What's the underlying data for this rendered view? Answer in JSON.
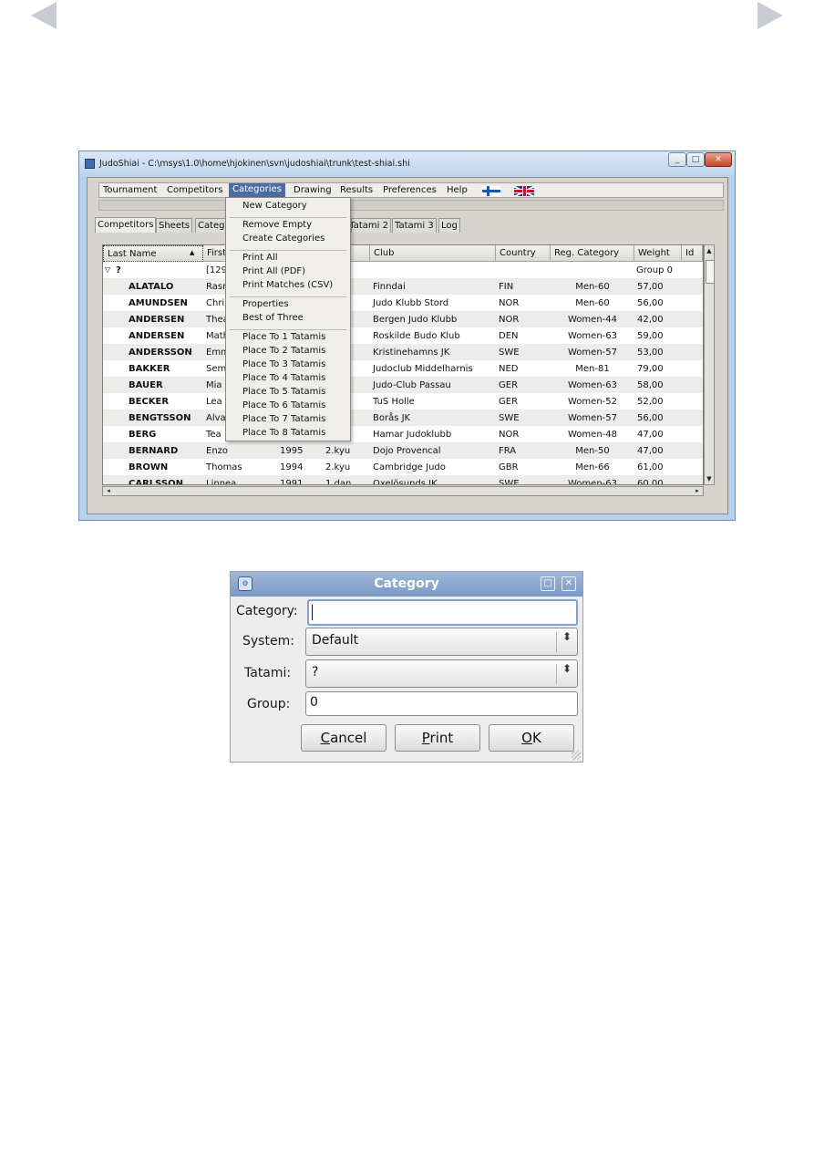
{
  "page": {
    "prev_icon": "triangle-left-icon",
    "next_icon": "triangle-right-icon"
  },
  "main_window": {
    "title": "JudoShiai - C:\\msys\\1.0\\home\\hjokinen\\svn\\judoshiai\\trunk\\test-shiai.shi",
    "window_buttons": {
      "minimize": "_",
      "maximize": "□",
      "close": "✕"
    },
    "menu": [
      "Tournament",
      "Competitors",
      "Categories",
      "Drawing",
      "Results",
      "Preferences",
      "Help"
    ],
    "active_menu": "Categories",
    "flags": [
      "finnish-flag-icon",
      "uk-flag-icon"
    ],
    "tabs": [
      "Competitors",
      "Sheets",
      "Catego",
      "Tatami 2",
      "Tatami 3",
      "Log"
    ],
    "active_tab": "Competitors",
    "columns": [
      "Last Name",
      "First",
      "Club",
      "Country",
      "Reg. Category",
      "Weight",
      "Id"
    ],
    "sort_indicator": "▲",
    "group_row": {
      "expander": "▽",
      "label": "?",
      "first": "[129",
      "weight": "Group 0"
    },
    "rows": [
      {
        "last": "ALATALO",
        "first": "Rasm",
        "birth": "",
        "grade": "",
        "club": "Finndai",
        "country": "FIN",
        "category": "Men-60",
        "weight": "57,00"
      },
      {
        "last": "AMUNDSEN",
        "first": "Chris",
        "birth": "",
        "grade": "",
        "club": "Judo Klubb Stord",
        "country": "NOR",
        "category": "Men-60",
        "weight": "56,00"
      },
      {
        "last": "ANDERSEN",
        "first": "Thea",
        "birth": "",
        "grade": "",
        "club": "Bergen Judo Klubb",
        "country": "NOR",
        "category": "Women-44",
        "weight": "42,00"
      },
      {
        "last": "ANDERSEN",
        "first": "Math",
        "birth": "",
        "grade": "",
        "club": "Roskilde Budo Klub",
        "country": "DEN",
        "category": "Women-63",
        "weight": "59,00"
      },
      {
        "last": "ANDERSSON",
        "first": "Emm",
        "birth": "",
        "grade": "",
        "club": "Kristinehamns JK",
        "country": "SWE",
        "category": "Women-57",
        "weight": "53,00"
      },
      {
        "last": "BAKKER",
        "first": "Sem",
        "birth": "",
        "grade": "",
        "club": "Judoclub Middelharnis",
        "country": "NED",
        "category": "Men-81",
        "weight": "79,00"
      },
      {
        "last": "BAUER",
        "first": "Mia",
        "birth": "",
        "grade": "",
        "club": "Judo-Club Passau",
        "country": "GER",
        "category": "Women-63",
        "weight": "58,00"
      },
      {
        "last": "BECKER",
        "first": "Lea",
        "birth": "",
        "grade": "",
        "club": "TuS Holle",
        "country": "GER",
        "category": "Women-52",
        "weight": "52,00"
      },
      {
        "last": "BENGTSSON",
        "first": "Alva",
        "birth": "",
        "grade": "",
        "club": "Borås JK",
        "country": "SWE",
        "category": "Women-57",
        "weight": "56,00"
      },
      {
        "last": "BERG",
        "first": "Tea",
        "birth": "",
        "grade": "",
        "club": "Hamar Judoklubb",
        "country": "NOR",
        "category": "Women-48",
        "weight": "47,00"
      },
      {
        "last": "BERNARD",
        "first": "Enzo",
        "birth": "1995",
        "grade": "2.kyu",
        "club": "Dojo Provencal",
        "country": "FRA",
        "category": "Men-50",
        "weight": "47,00"
      },
      {
        "last": "BROWN",
        "first": "Thomas",
        "birth": "1994",
        "grade": "2.kyu",
        "club": "Cambridge Judo",
        "country": "GBR",
        "category": "Men-66",
        "weight": "61,00"
      },
      {
        "last": "CARLSSON",
        "first": "Linnea",
        "birth": "1991",
        "grade": "1.dan",
        "club": "Oxelösunds JK",
        "country": "SWE",
        "category": "Women-63",
        "weight": "60,00"
      }
    ],
    "scroll_icons": {
      "up": "▲",
      "down": "▼",
      "left": "◂",
      "right": "▸"
    },
    "categories_menu": {
      "groups": [
        [
          "New Category"
        ],
        [
          "Remove Empty",
          "Create Categories"
        ],
        [
          "Print All",
          "Print All (PDF)",
          "Print Matches (CSV)"
        ],
        [
          "Properties",
          "Best of Three"
        ],
        [
          "Place To 1 Tatamis",
          "Place To 2 Tatamis",
          "Place To 3 Tatamis",
          "Place To 4 Tatamis",
          "Place To 5 Tatamis",
          "Place To 6 Tatamis",
          "Place To 7 Tatamis",
          "Place To 8 Tatamis"
        ]
      ]
    }
  },
  "dialog": {
    "title": "Category",
    "icon": "app-icon",
    "title_buttons": {
      "maximize": "□",
      "close": "✕"
    },
    "fields": {
      "category_label": "Category:",
      "category_value": "",
      "system_label": "System:",
      "system_value": "Default",
      "tatami_label": "Tatami:",
      "tatami_value": "?",
      "group_label": "Group:",
      "group_value": "0"
    },
    "combo_arrow": "⬍",
    "buttons": {
      "cancel": {
        "mnemonic": "C",
        "rest": "ancel"
      },
      "print": {
        "mnemonic": "P",
        "rest": "rint"
      },
      "ok": {
        "mnemonic": "O",
        "rest": "K"
      }
    }
  }
}
